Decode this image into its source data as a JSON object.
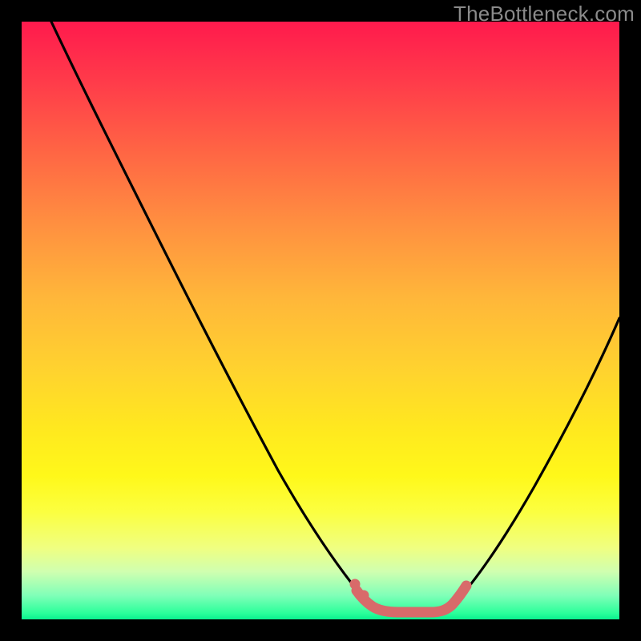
{
  "watermark": "TheBottleneck.com",
  "colors": {
    "curve": "#000000",
    "accent": "#d86a6a",
    "frame": "#000000"
  },
  "chart_data": {
    "type": "line",
    "title": "",
    "xlabel": "",
    "ylabel": "",
    "xlim": [
      0,
      100
    ],
    "ylim": [
      0,
      100
    ],
    "grid": false,
    "legend": "none",
    "annotations": [],
    "series": [
      {
        "name": "left-curve",
        "x": [
          5,
          10,
          15,
          20,
          25,
          30,
          35,
          40,
          45,
          50,
          55,
          58
        ],
        "y": [
          100,
          90,
          79,
          68,
          57,
          46,
          36,
          27,
          18,
          10,
          4,
          1
        ]
      },
      {
        "name": "right-curve",
        "x": [
          72,
          76,
          80,
          84,
          88,
          92,
          96,
          100
        ],
        "y": [
          1,
          6,
          13,
          21,
          30,
          40,
          50,
          60
        ]
      },
      {
        "name": "flat-segment-accent",
        "x": [
          56,
          58,
          60,
          62,
          64,
          66,
          68,
          70,
          72,
          74
        ],
        "y": [
          3,
          1.5,
          0.8,
          0.5,
          0.5,
          0.5,
          0.8,
          1.5,
          3,
          5
        ]
      }
    ]
  }
}
